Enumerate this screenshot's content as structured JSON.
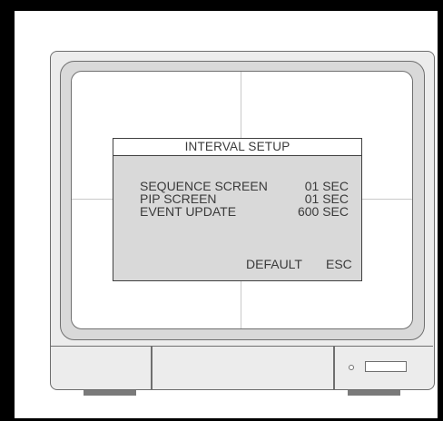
{
  "dialog": {
    "title": "INTERVAL SETUP",
    "rows": [
      {
        "label": "SEQUENCE SCREEN",
        "value": "01 SEC"
      },
      {
        "label": "PIP SCREEN",
        "value": "01 SEC"
      },
      {
        "label": "EVENT UPDATE",
        "value": "600 SEC"
      }
    ],
    "buttons": {
      "default_label": "DEFAULT",
      "esc_label": "ESC"
    }
  },
  "colors": {
    "dialog_bg": "#d9d9d9",
    "text": "#3a3a3a",
    "outline": "#6f6f6f"
  }
}
